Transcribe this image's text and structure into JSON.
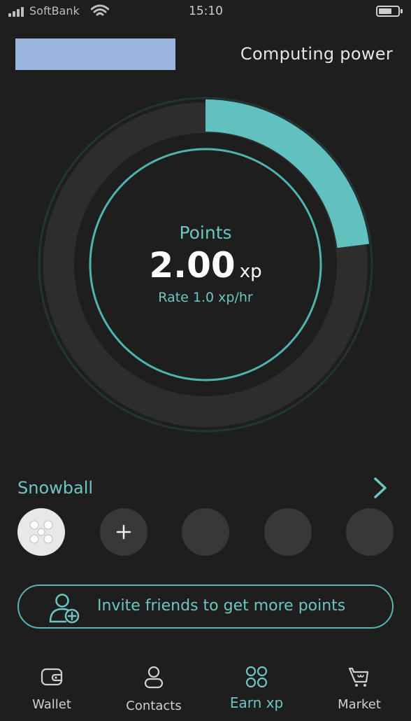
{
  "status_bar": {
    "carrier": "SoftBank",
    "time": "15:10"
  },
  "header": {
    "title": "Computing power"
  },
  "gauge": {
    "label": "Points",
    "value": "2.00",
    "unit": "xp",
    "rate": "Rate 1.0 xp/hr",
    "progress_fraction": 0.23,
    "colors": {
      "accent": "#61c1be",
      "track": "#2c2c2c",
      "inner_ring": "#4fb3b0"
    }
  },
  "snowball": {
    "title": "Snowball",
    "slots": [
      {
        "type": "member",
        "icon": "snowball-member-icon"
      },
      {
        "type": "add",
        "label": "+"
      },
      {
        "type": "empty"
      },
      {
        "type": "empty"
      },
      {
        "type": "empty"
      }
    ]
  },
  "invite": {
    "label": "Invite friends to get more points",
    "icon": "add-user-icon"
  },
  "tabs": [
    {
      "label": "Wallet",
      "icon": "wallet-icon",
      "active": false
    },
    {
      "label": "Contacts",
      "icon": "contacts-icon",
      "active": false
    },
    {
      "label": "Earn xp",
      "icon": "earn-grid-icon",
      "active": true
    },
    {
      "label": "Market",
      "icon": "cart-icon",
      "active": false
    }
  ]
}
